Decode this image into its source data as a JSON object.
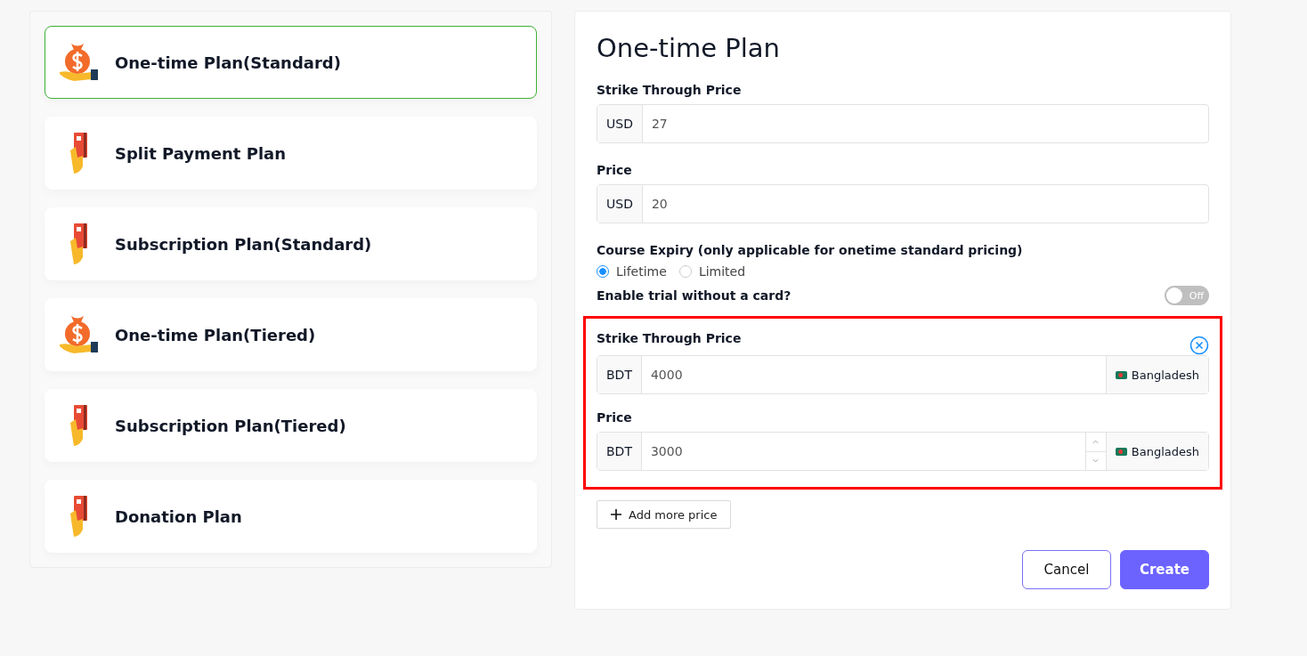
{
  "plans": [
    {
      "label": "One-time Plan(Standard)",
      "kind": "money-bag",
      "selected": true
    },
    {
      "label": "Split Payment Plan",
      "kind": "card",
      "selected": false
    },
    {
      "label": "Subscription Plan(Standard)",
      "kind": "card",
      "selected": false
    },
    {
      "label": "One-time Plan(Tiered)",
      "kind": "money-bag",
      "selected": false
    },
    {
      "label": "Subscription Plan(Tiered)",
      "kind": "card",
      "selected": false
    },
    {
      "label": "Donation Plan",
      "kind": "card",
      "selected": false
    }
  ],
  "form": {
    "title": "One-time Plan",
    "fields": [
      {
        "label": "Strike Through Price",
        "currency": "USD",
        "value": "27"
      },
      {
        "label": "Price",
        "currency": "USD",
        "value": "20"
      }
    ],
    "expiry": {
      "label": "Course Expiry (only applicable for onetime standard pricing)",
      "options": [
        {
          "label": "Lifetime",
          "selected": true
        },
        {
          "label": "Limited",
          "selected": false
        }
      ]
    },
    "trial": {
      "label": "Enable trial without a card?",
      "on": false,
      "state_label": "Off"
    },
    "regional_prices": [
      {
        "label": "Strike Through Price",
        "currency": "BDT",
        "value": "4000",
        "country": "Bangladesh",
        "stepper": false
      },
      {
        "label": "Price",
        "currency": "BDT",
        "value": "3000",
        "country": "Bangladesh",
        "stepper": true
      }
    ],
    "add_button": "Add more price",
    "buttons": [
      {
        "label": "Cancel",
        "kind": "secondary"
      },
      {
        "label": "Create",
        "kind": "primary"
      }
    ]
  }
}
